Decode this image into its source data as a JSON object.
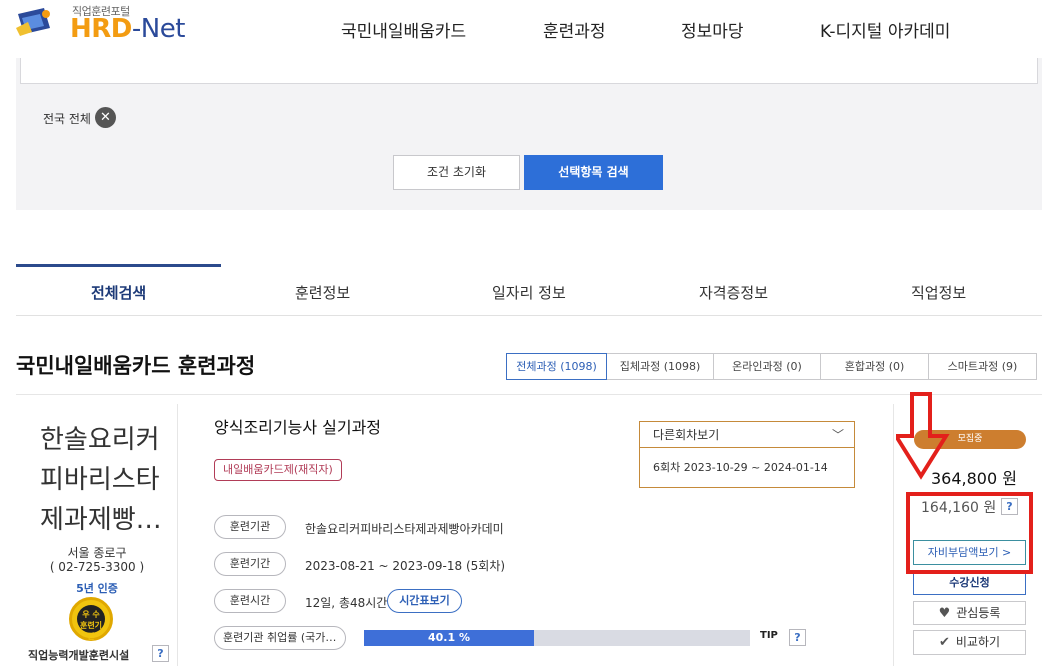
{
  "header": {
    "logo_subtitle": "직업훈련포털",
    "logo_hrd": "HRD",
    "logo_net": "-Net",
    "nav": [
      "국민내일배움카드",
      "훈련과정",
      "정보마당",
      "K-디지털 아카데미"
    ]
  },
  "filter": {
    "region": "전국 전체",
    "reset_label": "조건 초기화",
    "search_label": "선택항목 검색"
  },
  "tabs": [
    "전체검색",
    "훈련정보",
    "일자리 정보",
    "자격증정보",
    "직업정보"
  ],
  "section": {
    "title": "국민내일배움카드 훈련과정",
    "filter_tabs": [
      "전체과정 (1098)",
      "집체과정 (1098)",
      "온라인과정 (0)",
      "혼합과정 (0)",
      "스마트과정 (9)"
    ]
  },
  "course": {
    "institution_name": "한솔요리커피바리스타제과제빵…",
    "institution_lines": [
      "한솔요리커",
      "피바리스타",
      "제과제빵…"
    ],
    "location": "서울 종로구",
    "phone": "( 02-725-3300 )",
    "certification": "5년 인증",
    "badge_top": "우 수",
    "badge_bottom": "훈련기관",
    "institution_type": "직업능력개발훈련시설",
    "title": "양식조리기능사 실기과정",
    "tag": "내일배움카드제(재직자)",
    "info": [
      {
        "label": "훈련기관",
        "value": "한솔요리커피바리스타제과제빵아카데미"
      },
      {
        "label": "훈련기간",
        "value": "2023-08-21 ~ 2023-09-18 (5회차)"
      },
      {
        "label": "훈련시간",
        "value": "12일, 총48시간"
      }
    ],
    "timetable_label": "시간표보기",
    "employment_label": "훈련기관 취업률 (국가…",
    "employment_rate": 40.1,
    "employment_rate_text": "40.1 %",
    "tip_label": "TIP",
    "help_label": "?",
    "other_rounds_label": "다른회차보기",
    "other_round_item": "6회차 2023-10-29 ~ 2024-01-14",
    "status": "모집중",
    "price": "364,800 원",
    "self_pay": "164,160 원",
    "self_pay_btn": "자비부담액보기 >",
    "apply_btn": "수강신청",
    "favorite_btn": "관심등록",
    "compare_btn": "비교하기"
  },
  "colors": {
    "primary": "#2d6fd8",
    "accent_orange": "#cd7e2f",
    "annotation_red": "#e3201b",
    "tag_red": "#b13c57"
  }
}
